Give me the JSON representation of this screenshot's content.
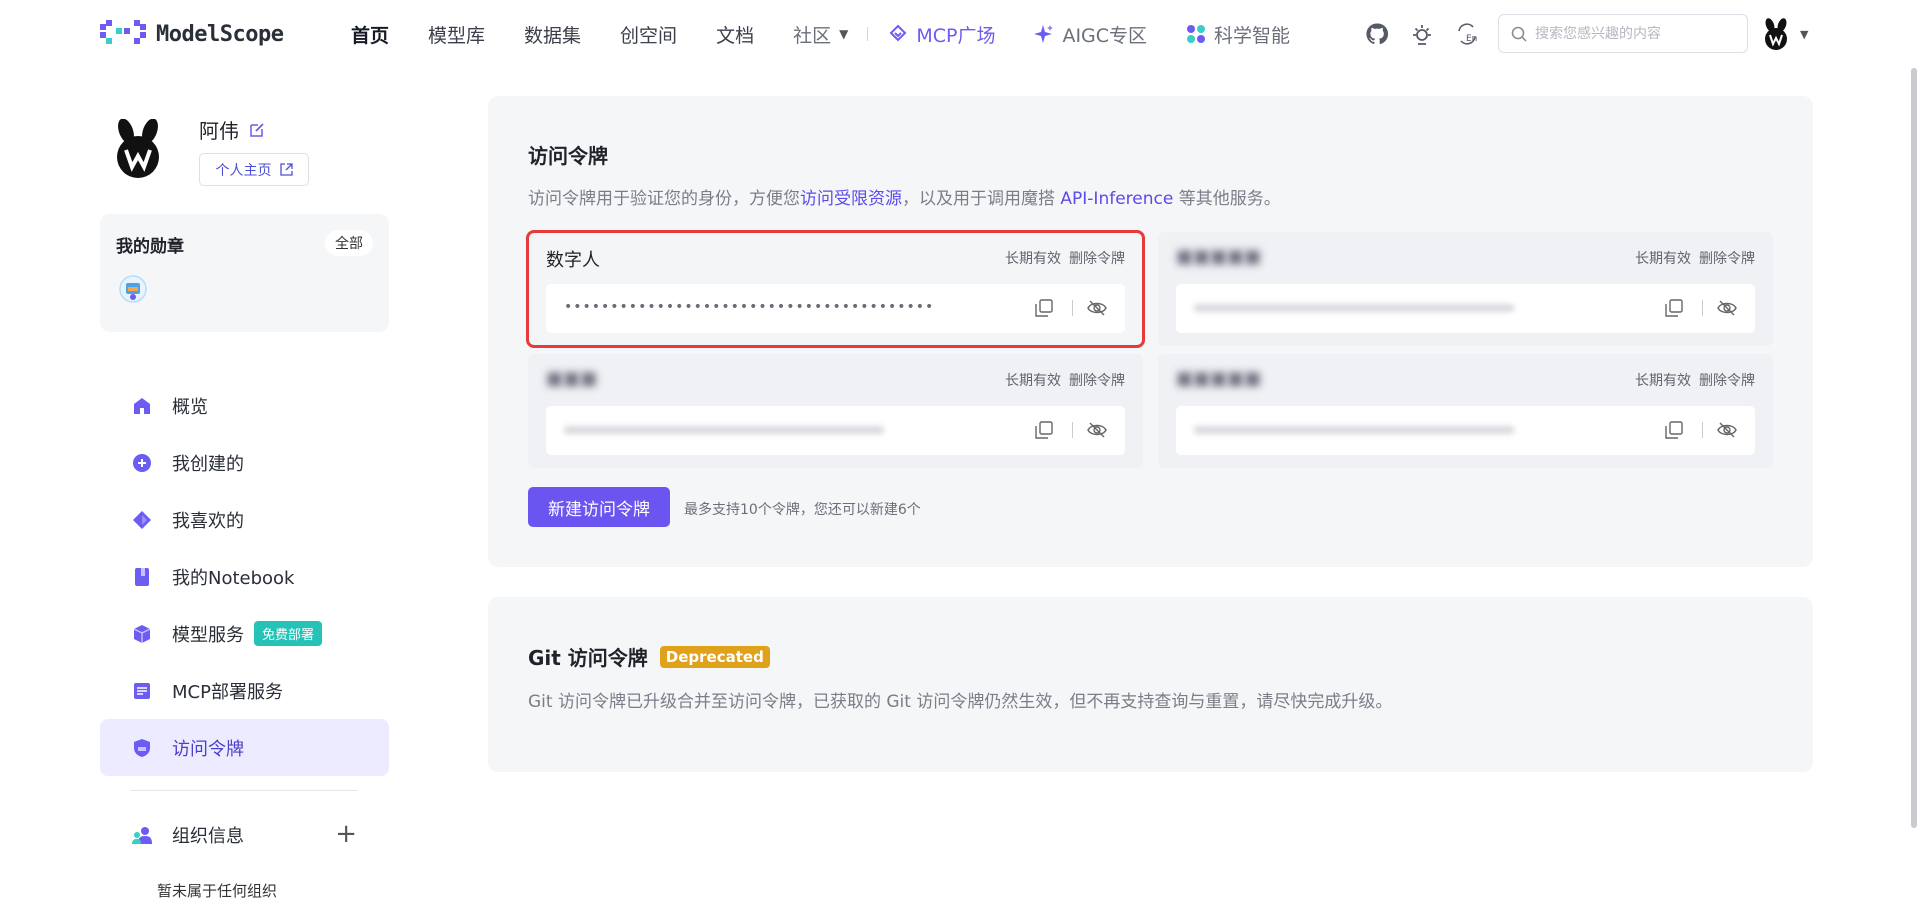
{
  "header": {
    "logo_text": "ModelScope",
    "nav": [
      {
        "label": "首页",
        "active": true
      },
      {
        "label": "模型库"
      },
      {
        "label": "数据集"
      },
      {
        "label": "创空间"
      },
      {
        "label": "文档"
      },
      {
        "label": "社区"
      },
      {
        "label": "MCP广场"
      },
      {
        "label": "AIGC专区"
      },
      {
        "label": "科学智能"
      }
    ],
    "search_placeholder": "搜索您感兴趣的内容",
    "accent_color": "#6c5cf1"
  },
  "profile": {
    "name": "阿伟",
    "home_link": "个人主页"
  },
  "badges": {
    "title": "我的勋章",
    "all_label": "全部"
  },
  "sidebar": {
    "items": [
      {
        "label": "概览",
        "icon": "home-icon"
      },
      {
        "label": "我创建的",
        "icon": "plus-circle-icon"
      },
      {
        "label": "我喜欢的",
        "icon": "diamond-icon"
      },
      {
        "label": "我的Notebook",
        "icon": "notebook-icon"
      },
      {
        "label": "模型服务",
        "icon": "cube-icon",
        "tag": "免费部署"
      },
      {
        "label": "MCP部署服务",
        "icon": "server-icon"
      },
      {
        "label": "访问令牌",
        "icon": "shield-icon",
        "active": true
      }
    ],
    "org_label": "组织信息",
    "org_empty": "暂未属于任何组织"
  },
  "tokens_card": {
    "title": "访问令牌",
    "desc_pre": "访问令牌用于验证您的身份，方便您",
    "desc_link1": "访问受限资源",
    "desc_mid": "，以及用于调用魔搭 ",
    "desc_link2": "API-Inference",
    "desc_post": " 等其他服务。",
    "tokens": [
      {
        "name": "数字人",
        "validity": "长期有效",
        "delete": "删除令牌",
        "value": "••••••••••••••••••••••••••••••••••••••••"
      },
      {
        "name": "",
        "validity": "长期有效",
        "delete": "删除令牌",
        "value": ""
      },
      {
        "name": "",
        "validity": "长期有效",
        "delete": "删除令牌",
        "value": ""
      },
      {
        "name": "",
        "validity": "长期有效",
        "delete": "删除令牌",
        "value": ""
      }
    ],
    "new_button": "新建访问令牌",
    "hint": "最多支持10个令牌，您还可以新建6个"
  },
  "git_card": {
    "title": "Git 访问令牌",
    "badge": "Deprecated",
    "desc": "Git 访问令牌已升级合并至访问令牌，已获取的 Git 访问令牌仍然生效，但不再支持查询与重置，请尽快完成升级。"
  }
}
